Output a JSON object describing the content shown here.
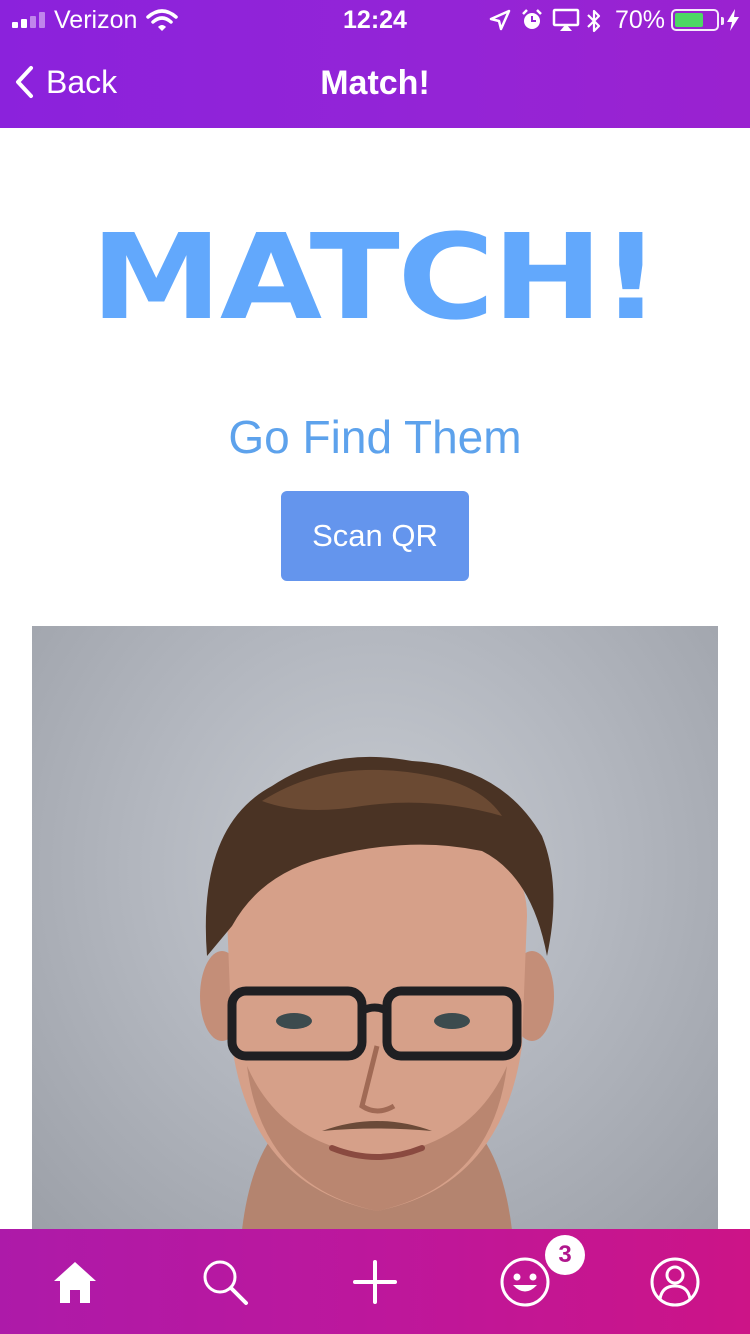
{
  "status_bar": {
    "carrier": "Verizon",
    "time": "12:24",
    "battery_percent_text": "70%",
    "battery_level": 0.7,
    "battery_color": "#4cd964"
  },
  "nav": {
    "back_label": "Back",
    "title": "Match!"
  },
  "main": {
    "hero_text": "MATCH!",
    "subtitle": "Go Find Them",
    "scan_button_label": "Scan QR",
    "photo_icon": "profile-photo"
  },
  "tab_bar": {
    "items": [
      {
        "icon": "home-icon",
        "active": true
      },
      {
        "icon": "search-icon",
        "active": false
      },
      {
        "icon": "plus-icon",
        "active": false
      },
      {
        "icon": "smiley-icon",
        "active": false
      },
      {
        "icon": "profile-icon",
        "active": false
      }
    ],
    "badge_count": "3"
  },
  "colors": {
    "header_gradient_start": "#8b22dc",
    "accent_blue": "#62a8fc",
    "subtitle_blue": "#5da2ec",
    "button_blue": "#6495ed",
    "tabbar_start": "#ad1aa9",
    "tabbar_end": "#cc1487"
  }
}
